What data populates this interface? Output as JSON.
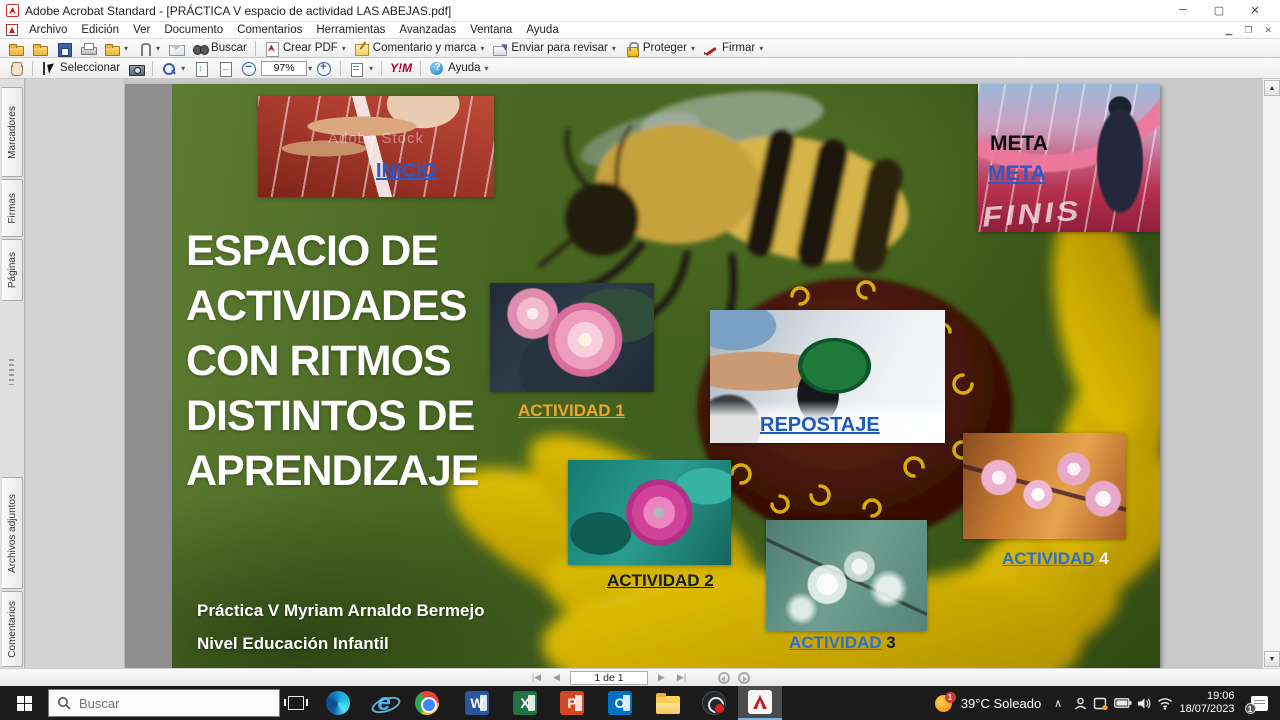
{
  "titlebar": {
    "title": "Adobe Acrobat Standard - [PRÁCTICA V espacio de actividad LAS ABEJAS.pdf]"
  },
  "menubar": {
    "items": [
      "Archivo",
      "Edición",
      "Ver",
      "Documento",
      "Comentarios",
      "Herramientas",
      "Avanzadas",
      "Ventana",
      "Ayuda"
    ]
  },
  "toolbar1": {
    "buscar_label": "Buscar",
    "crear_pdf_label": "Crear PDF",
    "comentario_label": "Comentario y marca",
    "enviar_label": "Enviar para revisar",
    "proteger_label": "Proteger",
    "firmar_label": "Firmar"
  },
  "toolbar2": {
    "seleccionar_label": "Seleccionar",
    "zoom_value": "97%",
    "ym_label": "Y!M",
    "ayuda_label": "Ayuda"
  },
  "sidebar": {
    "tabs": [
      "Marcadores",
      "Firmas",
      "Páginas",
      "Archivos adjuntos",
      "Comentarios"
    ]
  },
  "slide": {
    "title_lines": [
      "ESPACIO DE",
      "ACTIVIDADES",
      "CON RITMOS",
      "DISTINTOS DE",
      "APRENDIZAJE"
    ],
    "inicio_link": "INICIO",
    "inicio_watermark": "Adobe Stock",
    "meta_label": "META",
    "meta_link": "META",
    "meta_track_text": "FINIS",
    "repostaje_link": "REPOSTAJE",
    "actividades": [
      {
        "label": "ACTIVIDAD",
        "num": "1"
      },
      {
        "label": "ACTIVIDAD",
        "num": "2"
      },
      {
        "label": "ACTIVIDAD",
        "num": "3"
      },
      {
        "label": "ACTIVIDAD",
        "num": "4"
      }
    ],
    "footer1": "Práctica V Myriam Arnaldo Bermejo",
    "footer2": "Nivel Educación Infantil"
  },
  "statusbar": {
    "page_indicator": "1 de 1"
  },
  "taskbar": {
    "search_placeholder": "Buscar",
    "weather": "39°C  Soleado",
    "weather_badge": "1",
    "time": "19:06",
    "date": "18/07/2023",
    "notification_badge": "1"
  },
  "colors": {
    "link_blue": "#2b59c8",
    "actividad_blue": "#2a6fd4",
    "actividad1_orange": "#eda62f",
    "slide_green": "#44621e",
    "acrobat_red": "#c21f25",
    "taskbar_bg": "#1b1b1b"
  }
}
